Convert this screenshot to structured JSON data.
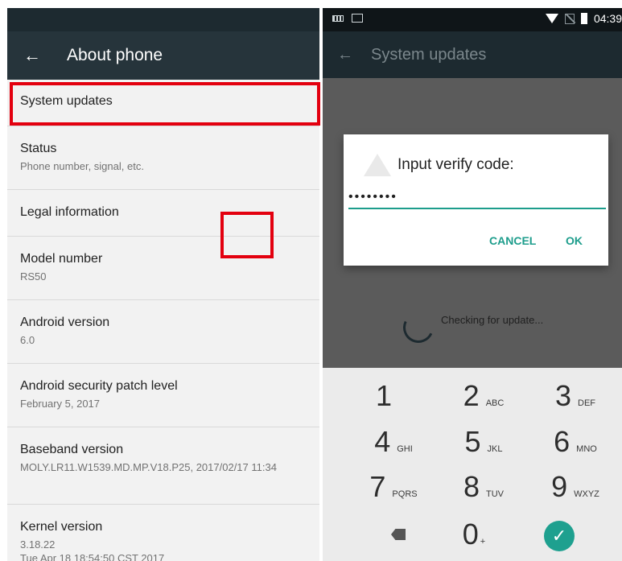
{
  "left": {
    "title": "About phone",
    "back_icon": "arrow-left-icon",
    "items": [
      {
        "title": "System updates",
        "subtitle": ""
      },
      {
        "title": "Status",
        "subtitle": "Phone number, signal, etc."
      },
      {
        "title": "Legal information",
        "subtitle": ""
      },
      {
        "title": "Model number",
        "subtitle": "RS50"
      },
      {
        "title": "Android version",
        "subtitle": "6.0"
      },
      {
        "title": "Android security patch level",
        "subtitle": "February 5, 2017"
      },
      {
        "title": "Baseband version",
        "subtitle": "MOLY.LR11.W1539.MD.MP.V18.P25, 2017/02/17 11:34"
      },
      {
        "title": "Kernel version",
        "subtitle": "3.18.22",
        "subtitle2": "Tue Apr 18 18:54:50 CST 2017"
      }
    ]
  },
  "right": {
    "status": {
      "time": "04:39"
    },
    "title": "System updates",
    "checking_text": "Checking for update...",
    "dialog": {
      "title": "Input verify code:",
      "password_value": "••••••••",
      "cancel_label": "CANCEL",
      "ok_label": "OK"
    },
    "keypad": [
      {
        "digit": "1",
        "letters": ""
      },
      {
        "digit": "2",
        "letters": "ABC"
      },
      {
        "digit": "3",
        "letters": "DEF"
      },
      {
        "digit": "4",
        "letters": "GHI"
      },
      {
        "digit": "5",
        "letters": "JKL"
      },
      {
        "digit": "6",
        "letters": "MNO"
      },
      {
        "digit": "7",
        "letters": "PQRS"
      },
      {
        "digit": "8",
        "letters": "TUV"
      },
      {
        "digit": "9",
        "letters": "WXYZ"
      },
      {
        "digit": "0",
        "letters": "+"
      }
    ]
  },
  "colors": {
    "accent": "#1d9d8c",
    "highlight": "#e3000f",
    "appbar": "#26343b"
  }
}
